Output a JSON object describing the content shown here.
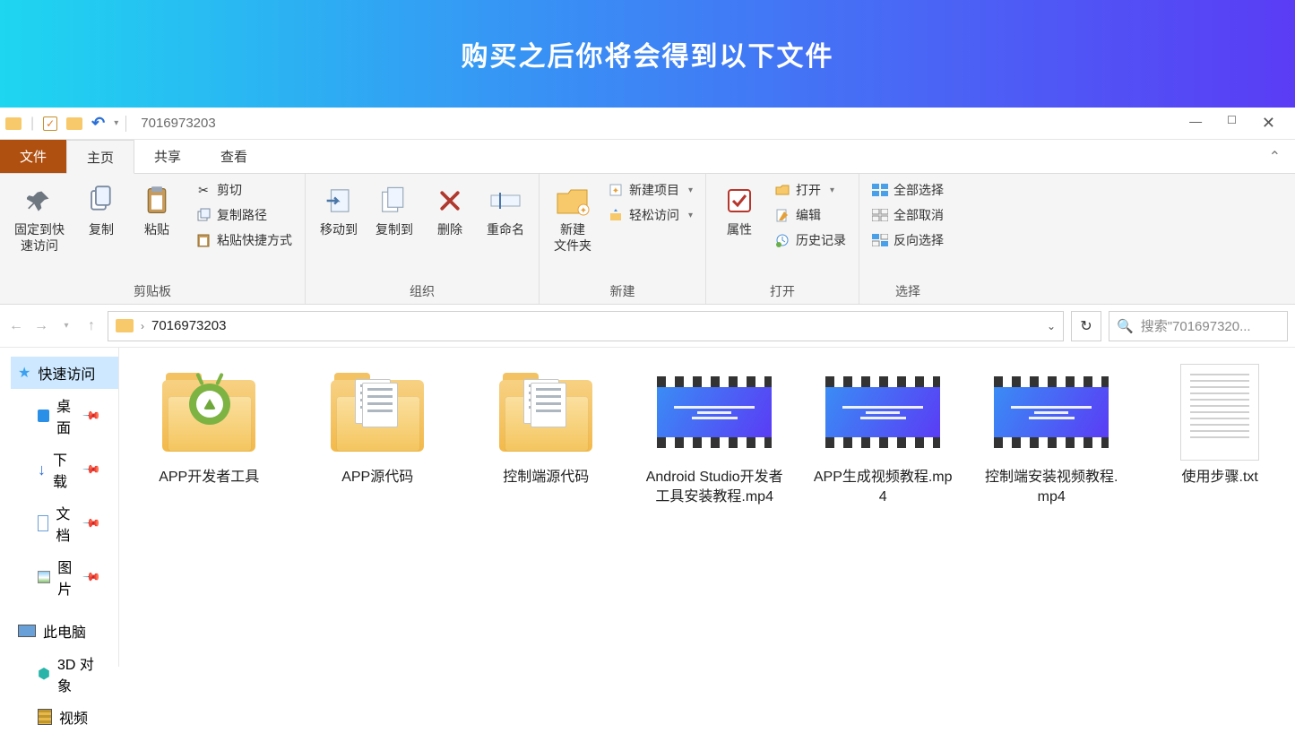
{
  "banner": {
    "text": "购买之后你将会得到以下文件"
  },
  "titlebar": {
    "title": "7016973203"
  },
  "tabs": {
    "file": "文件",
    "home": "主页",
    "share": "共享",
    "view": "查看"
  },
  "ribbon": {
    "pin": "固定到快\n速访问",
    "copy": "复制",
    "paste": "粘贴",
    "cut": "剪切",
    "copy_path": "复制路径",
    "paste_shortcut": "粘贴快捷方式",
    "group_clipboard": "剪贴板",
    "move_to": "移动到",
    "copy_to": "复制到",
    "delete": "删除",
    "rename": "重命名",
    "group_organize": "组织",
    "new_folder": "新建\n文件夹",
    "new_item": "新建项目",
    "easy_access": "轻松访问",
    "group_new": "新建",
    "properties": "属性",
    "open": "打开",
    "edit": "编辑",
    "history": "历史记录",
    "group_open": "打开",
    "select_all": "全部选择",
    "select_none": "全部取消",
    "invert_sel": "反向选择",
    "group_select": "选择"
  },
  "nav": {
    "path": "7016973203",
    "search_placeholder": "搜索\"701697320..."
  },
  "sidebar": {
    "quick_access": "快速访问",
    "desktop": "桌面",
    "downloads": "下载",
    "documents": "文档",
    "pictures": "图片",
    "this_pc": "此电脑",
    "objects_3d": "3D 对象",
    "videos": "视频"
  },
  "files": [
    {
      "type": "folder_android",
      "name": "APP开发者工具"
    },
    {
      "type": "folder_code",
      "name": "APP源代码"
    },
    {
      "type": "folder_code",
      "name": "控制端源代码"
    },
    {
      "type": "video",
      "name": "Android Studio开发者工具安装教程.mp4"
    },
    {
      "type": "video",
      "name": "APP生成视频教程.mp4"
    },
    {
      "type": "video",
      "name": "控制端安装视频教程.mp4"
    },
    {
      "type": "txt",
      "name": "使用步骤.txt"
    }
  ]
}
